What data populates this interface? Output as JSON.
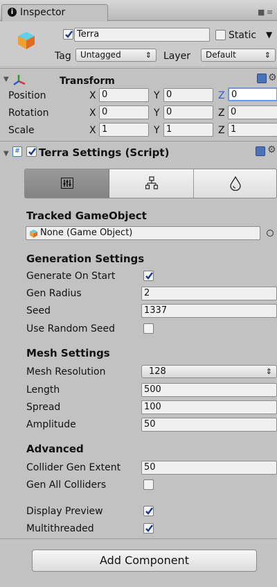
{
  "tab": {
    "label": "Inspector"
  },
  "object": {
    "name": "Terra",
    "static_label": "Static",
    "tag_label": "Tag",
    "tag_value": "Untagged",
    "layer_label": "Layer",
    "layer_value": "Default"
  },
  "transform": {
    "title": "Transform",
    "rows": [
      {
        "label": "Position",
        "x": "0",
        "y": "0",
        "z": "0"
      },
      {
        "label": "Rotation",
        "x": "0",
        "y": "0",
        "z": "0"
      },
      {
        "label": "Scale",
        "x": "1",
        "y": "1",
        "z": "1"
      }
    ],
    "axis_x": "X",
    "axis_y": "Y",
    "axis_z": "Z"
  },
  "script": {
    "title": "Terra Settings (Script)"
  },
  "tracked": {
    "heading": "Tracked GameObject",
    "value": "None (Game Object)"
  },
  "generation": {
    "heading": "Generation Settings",
    "generate_on_start": "Generate On Start",
    "gen_radius_label": "Gen Radius",
    "gen_radius": "2",
    "seed_label": "Seed",
    "seed": "1337",
    "use_random_seed": "Use Random Seed"
  },
  "mesh": {
    "heading": "Mesh Settings",
    "resolution_label": "Mesh Resolution",
    "resolution": "128",
    "length_label": "Length",
    "length": "500",
    "spread_label": "Spread",
    "spread": "100",
    "amplitude_label": "Amplitude",
    "amplitude": "50"
  },
  "advanced": {
    "heading": "Advanced",
    "collider_label": "Collider Gen Extent",
    "collider": "50",
    "gen_all_colliders": "Gen All Colliders",
    "display_preview": "Display Preview",
    "multithreaded": "Multithreaded"
  },
  "add_component": "Add Component"
}
